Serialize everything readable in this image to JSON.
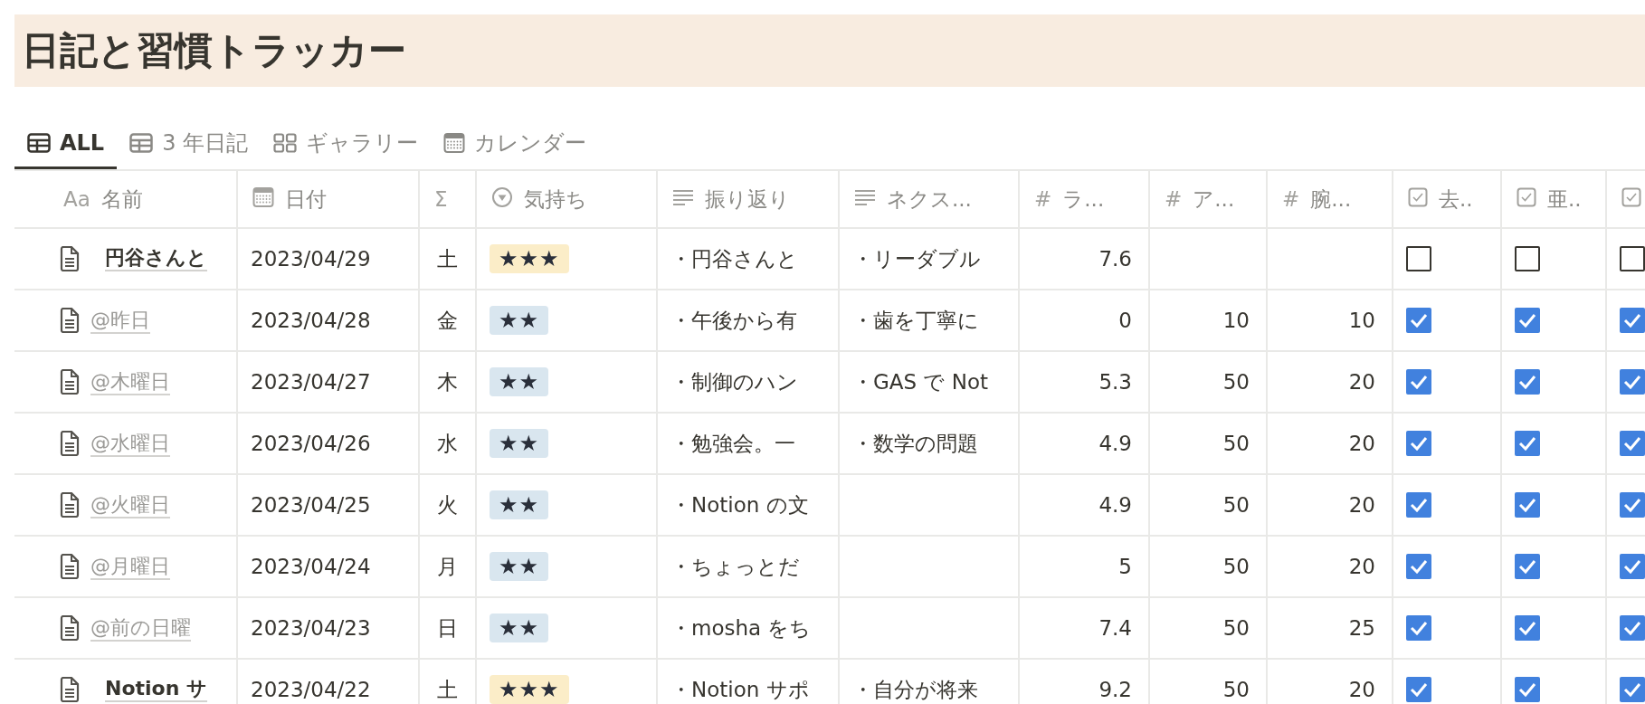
{
  "title": "日記と習慣トラッカー",
  "tabs": [
    {
      "label": "ALL",
      "kind": "table",
      "selected": true
    },
    {
      "label": "3 年日記",
      "kind": "table",
      "selected": false
    },
    {
      "label": "ギャラリー",
      "kind": "gallery",
      "selected": false
    },
    {
      "label": "カレンダー",
      "kind": "calendar",
      "selected": false
    }
  ],
  "columns": [
    {
      "kind": "title",
      "symbol": "Aa",
      "label": "名前"
    },
    {
      "kind": "date",
      "label": "日付"
    },
    {
      "kind": "formula",
      "symbol": "Σ"
    },
    {
      "kind": "select",
      "label": "気持ち"
    },
    {
      "kind": "text",
      "label": "振り返り"
    },
    {
      "kind": "text",
      "label": "ネクス..."
    },
    {
      "kind": "number",
      "symbol": "#",
      "label": "ラ..."
    },
    {
      "kind": "number",
      "symbol": "#",
      "label": "ア..."
    },
    {
      "kind": "number",
      "symbol": "#",
      "label": "腕..."
    },
    {
      "kind": "checkbox",
      "label": "去.."
    },
    {
      "kind": "checkbox",
      "label": "亜.."
    },
    {
      "kind": "checkbox"
    }
  ],
  "rows": [
    {
      "name": "円谷さんと",
      "kind": "page",
      "date": "2023/04/29",
      "weekday": "土",
      "mood": {
        "label": "★★★",
        "color": "#fbedc8"
      },
      "reflection": "・円谷さんと",
      "next": "・リーダブル",
      "n1": "7.6",
      "checks": [
        false,
        false,
        false
      ]
    },
    {
      "name": "@昨日",
      "kind": "mention",
      "date": "2023/04/28",
      "weekday": "金",
      "mood": {
        "label": "★★",
        "color": "#d9e6ef"
      },
      "reflection": "・午後から有",
      "next": "・歯を丁寧に",
      "n1": "0",
      "n2": "10",
      "n3": "10",
      "checks": [
        true,
        true,
        true
      ]
    },
    {
      "name": "@木曜日",
      "kind": "mention",
      "date": "2023/04/27",
      "weekday": "木",
      "mood": {
        "label": "★★",
        "color": "#d9e6ef"
      },
      "reflection": "・制御のハン",
      "next": "・GAS で Not",
      "n1": "5.3",
      "n2": "50",
      "n3": "20",
      "checks": [
        true,
        true,
        true
      ]
    },
    {
      "name": "@水曜日",
      "kind": "mention",
      "date": "2023/04/26",
      "weekday": "水",
      "mood": {
        "label": "★★",
        "color": "#d9e6ef"
      },
      "reflection": "・勉強会。一",
      "next": "・数学の問題",
      "n1": "4.9",
      "n2": "50",
      "n3": "20",
      "checks": [
        true,
        true,
        true
      ]
    },
    {
      "name": "@火曜日",
      "kind": "mention",
      "date": "2023/04/25",
      "weekday": "火",
      "mood": {
        "label": "★★",
        "color": "#d9e6ef"
      },
      "reflection": "・Notion の文",
      "n1": "4.9",
      "n2": "50",
      "n3": "20",
      "checks": [
        true,
        true,
        true
      ]
    },
    {
      "name": "@月曜日",
      "kind": "mention",
      "date": "2023/04/24",
      "weekday": "月",
      "mood": {
        "label": "★★",
        "color": "#d9e6ef"
      },
      "reflection": "・ちょっとだ",
      "n1": "5",
      "n2": "50",
      "n3": "20",
      "checks": [
        true,
        true,
        true
      ]
    },
    {
      "name": "@前の日曜",
      "kind": "mention",
      "date": "2023/04/23",
      "weekday": "日",
      "mood": {
        "label": "★★",
        "color": "#d9e6ef"
      },
      "reflection": "・mosha をち",
      "n1": "7.4",
      "n2": "50",
      "n3": "25",
      "checks": [
        true,
        true,
        true
      ]
    },
    {
      "name": "Notion サ",
      "kind": "page",
      "date": "2023/04/22",
      "weekday": "土",
      "mood": {
        "label": "★★★",
        "color": "#fbedc8"
      },
      "reflection": "・Notion サポ",
      "next": "・自分が将来",
      "n1": "9.2",
      "n2": "50",
      "n3": "20",
      "checks": [
        true,
        true,
        true
      ]
    }
  ]
}
